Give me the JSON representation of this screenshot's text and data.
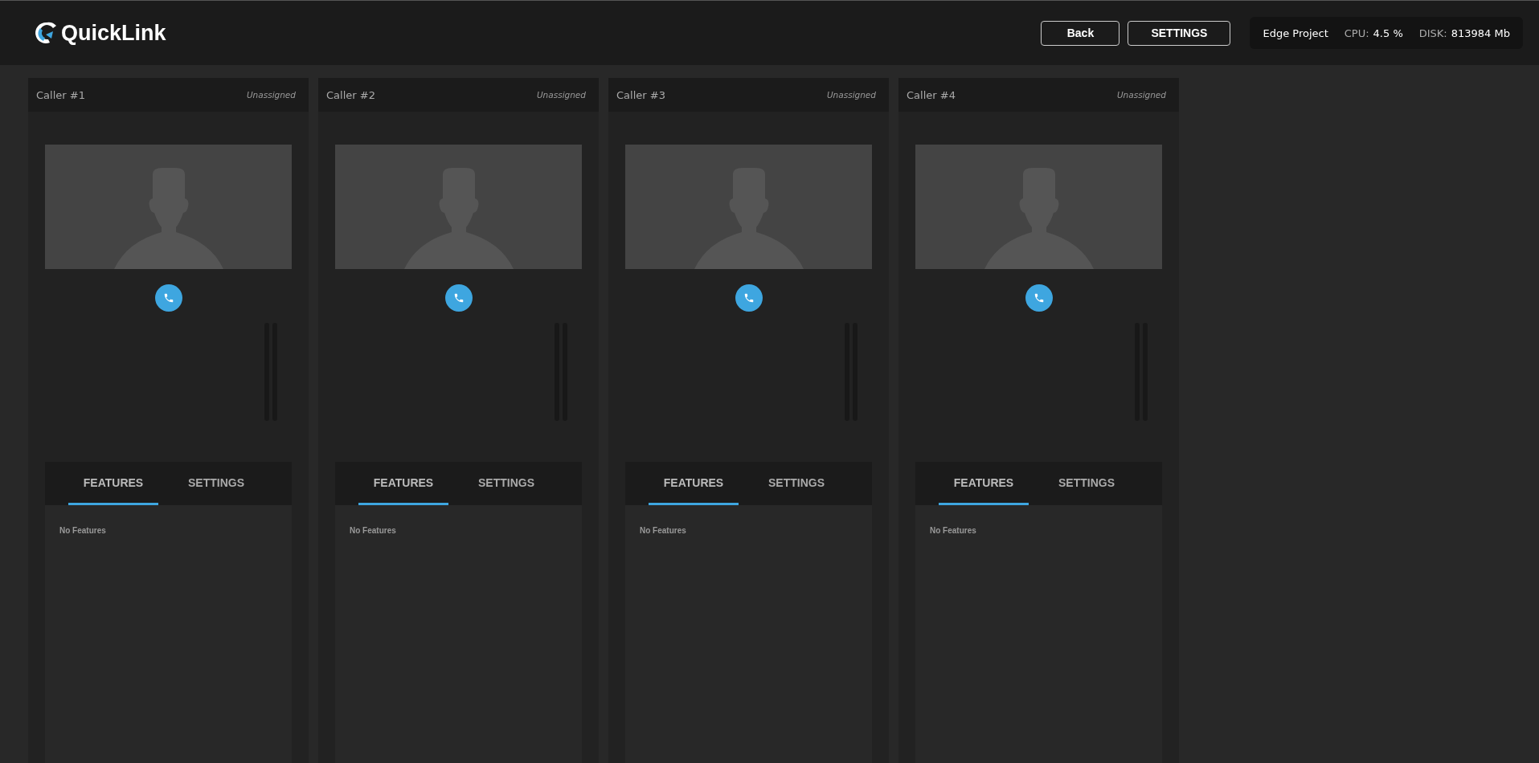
{
  "header": {
    "logo": "QuickLink",
    "buttons": [
      "Back",
      "SETTINGS"
    ],
    "status": {
      "project": "Edge Project",
      "cpu_label": "CPU:",
      "cpu_value": "4.5 %",
      "disk_label": "DISK:",
      "disk_value": "813984 Mb"
    }
  },
  "callers": [
    {
      "title": "Caller #1",
      "assignment": "Unassigned",
      "tabs": [
        {
          "label": "FEATURES",
          "selected": true
        },
        {
          "label": "SETTINGS",
          "selected": false
        }
      ],
      "empty_text": "No Features"
    },
    {
      "title": "Caller #2",
      "assignment": "Unassigned",
      "tabs": [
        {
          "label": "FEATURES",
          "selected": true
        },
        {
          "label": "SETTINGS",
          "selected": false
        }
      ],
      "empty_text": "No Features"
    },
    {
      "title": "Caller #3",
      "assignment": "Unassigned",
      "tabs": [
        {
          "label": "FEATURES",
          "selected": true
        },
        {
          "label": "SETTINGS",
          "selected": false
        }
      ],
      "empty_text": "No Features"
    },
    {
      "title": "Caller #4",
      "assignment": "Unassigned",
      "tabs": [
        {
          "label": "FEATURES",
          "selected": true
        },
        {
          "label": "SETTINGS",
          "selected": false
        }
      ],
      "empty_text": "No Features"
    }
  ]
}
